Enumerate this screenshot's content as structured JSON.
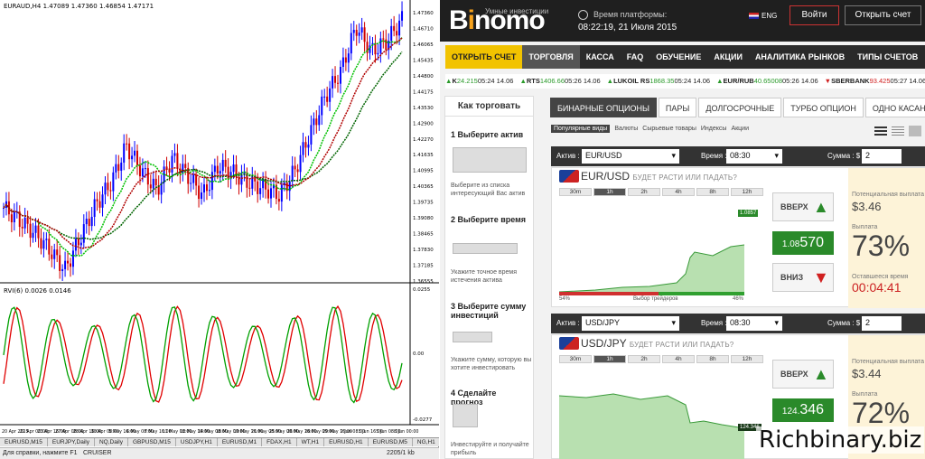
{
  "mt4": {
    "title": "EURAUD,H4  1.47089 1.47360 1.46854 1.47171",
    "osc_title": "RVI(6) 0.0026 0.0146",
    "price_labels": [
      "1.47360",
      "1.46710",
      "1.46065",
      "1.45435",
      "1.44800",
      "1.44175",
      "1.43530",
      "1.42900",
      "1.42270",
      "1.41635",
      "1.40995",
      "1.40365",
      "1.39735",
      "1.39080",
      "1.38465",
      "1.37830",
      "1.37185",
      "1.36555"
    ],
    "osc_labels": [
      "0.0255",
      "0.00",
      "-0.0277"
    ],
    "date_labels": [
      "20 Apr 2015",
      "22 Apr 00:00",
      "23 Apr 16:00",
      "27 Apr 08:00",
      "28 Apr 16:00",
      "30 Apr 08:00",
      "5 May 16:00",
      "6 May 08:00",
      "7 May 16:00",
      "11 May 08:00",
      "12 May 16:00",
      "14 May 08:00",
      "18 May 00:00",
      "19 May 16:00",
      "21 May 08:00",
      "25 May 00:00",
      "26 May 16:00",
      "28 May 00:00",
      "29 May 16:00",
      "2 Jun 08:00",
      "3 Jun 16:00",
      "5 Jun 08:00",
      "8 Jun 00:00"
    ],
    "tabs": [
      "EURUSD,M15",
      "EURJPY,Daily",
      "NQ,Daily",
      "GBPUSD,M15",
      "USDJPY,H1",
      "EURUSD,M1",
      "FDAX,H1",
      "WT,H1",
      "EURUSD,H1",
      "EURUSD,M5",
      "NG,H1",
      "NZDUS"
    ],
    "status_left": "Для справки, нажмите F1",
    "status_mid": "CRUISER",
    "status_right": "2205/1 kb"
  },
  "binomo": {
    "tagline": "Умные инвестиции",
    "time_label": "Время платформы:",
    "time_value": "08:22:19, 21 Июля 2015",
    "lang": "ENG",
    "login": "Войти",
    "open_account": "Открыть счет",
    "nav": [
      "ОТКРЫТЬ СЧЕТ",
      "ТОРГОВЛЯ",
      "КАССА",
      "FAQ",
      "ОБУЧЕНИЕ",
      "АКЦИИ",
      "АНАЛИТИКА РЫНКОВ",
      "ТИПЫ СЧЕТОВ",
      "О НАС"
    ],
    "ticker": [
      {
        "name": "K",
        "val": "24.215",
        "time": "05:24 14.06",
        "dir": "up"
      },
      {
        "name": "RTS",
        "val": "1406.66",
        "time": "05:26 14.06",
        "dir": "up"
      },
      {
        "name": "LUKOIL RS",
        "val": "1868.35",
        "time": "05:24 14.06",
        "dir": "up"
      },
      {
        "name": "EUR/RUB",
        "val": "40.65008",
        "time": "05:26 14.06",
        "dir": "up"
      },
      {
        "name": "SBERBANK",
        "val": "93.425",
        "time": "05:27 14.06",
        "dir": "dn"
      }
    ],
    "howto": {
      "title": "Как торговать",
      "steps": [
        {
          "title": "1 Выберите актив",
          "desc": "Выберите из списка интересующий Вас актив"
        },
        {
          "title": "2 Выберите время",
          "desc": "Укажите точное время истечения актива"
        },
        {
          "title": "3 Выберите сумму инвестиций",
          "desc": "Укажите сумму, которую вы хотите инвестировать"
        },
        {
          "title": "4 Сделайте прогноз",
          "desc": "Инвестируйте и получайте прибыль"
        }
      ]
    },
    "main_tabs": [
      "БИНАРНЫЕ ОПЦИОНЫ",
      "ПАРЫ",
      "ДОЛГОСРОЧНЫЕ",
      "ТУРБО ОПЦИОН",
      "ОДНО КАСАНИЕ"
    ],
    "sub_tabs": [
      "Популярные виды",
      "Валюты",
      "Сырьевые товары",
      "Индексы",
      "Акции"
    ],
    "labels": {
      "asset": "Актив :",
      "time": "Время :",
      "sum": "Сумма : $",
      "question": "БУДЕТ РАСТИ ИЛИ ПАДАТЬ?",
      "up": "ВВЕРХ",
      "down": "ВНИЗ",
      "potential": "Потенциальная выплата",
      "payout": "Выплата",
      "remaining": "Оставшееся время",
      "traders": "Выбор трейдеров"
    },
    "timeframes": [
      "30m",
      "1h",
      "2h",
      "4h",
      "8h",
      "12h"
    ],
    "options": [
      {
        "asset": "EUR/USD",
        "time": "08:30",
        "sum": "2",
        "price_main": "1.08",
        "price_big": "570",
        "potential": "$3.46",
        "payout": "73%",
        "countdown": "00:04:41",
        "chart_price": "1.0857",
        "chart_ticks": [
          "1.08456",
          "1.08373",
          "1.08289",
          "1.08204"
        ],
        "traders_left": "54%",
        "traders_right": "46%",
        "times": [
          "07:30",
          "07:45",
          "08:00",
          "08:15",
          "08:30"
        ]
      },
      {
        "asset": "USD/JPY",
        "time": "08:30",
        "sum": "2",
        "price_main": "124.",
        "price_big": "346",
        "potential": "$3.44",
        "payout": "72%",
        "chart_price": "124.346",
        "chart_ticks": [
          "124.432",
          "124.388",
          "124.344",
          "124.300",
          "124.256"
        ],
        "times": [
          "07:30",
          "07:45",
          "08:00",
          "08:15",
          "08:30"
        ]
      }
    ]
  },
  "watermark": "Richbinary.biz",
  "chart_data": [
    {
      "type": "line",
      "title": "EURAUD,H4",
      "series": [
        {
          "name": "EURAUD",
          "values": [
            1.395,
            1.39,
            1.385,
            1.378,
            1.37,
            1.383,
            1.396,
            1.405,
            1.42,
            1.41,
            1.402,
            1.415,
            1.408,
            1.4,
            1.412,
            1.409,
            1.405,
            1.403,
            1.4,
            1.41,
            1.425,
            1.44,
            1.45,
            1.468,
            1.458,
            1.462,
            1.471
          ]
        }
      ]
    }
  ]
}
